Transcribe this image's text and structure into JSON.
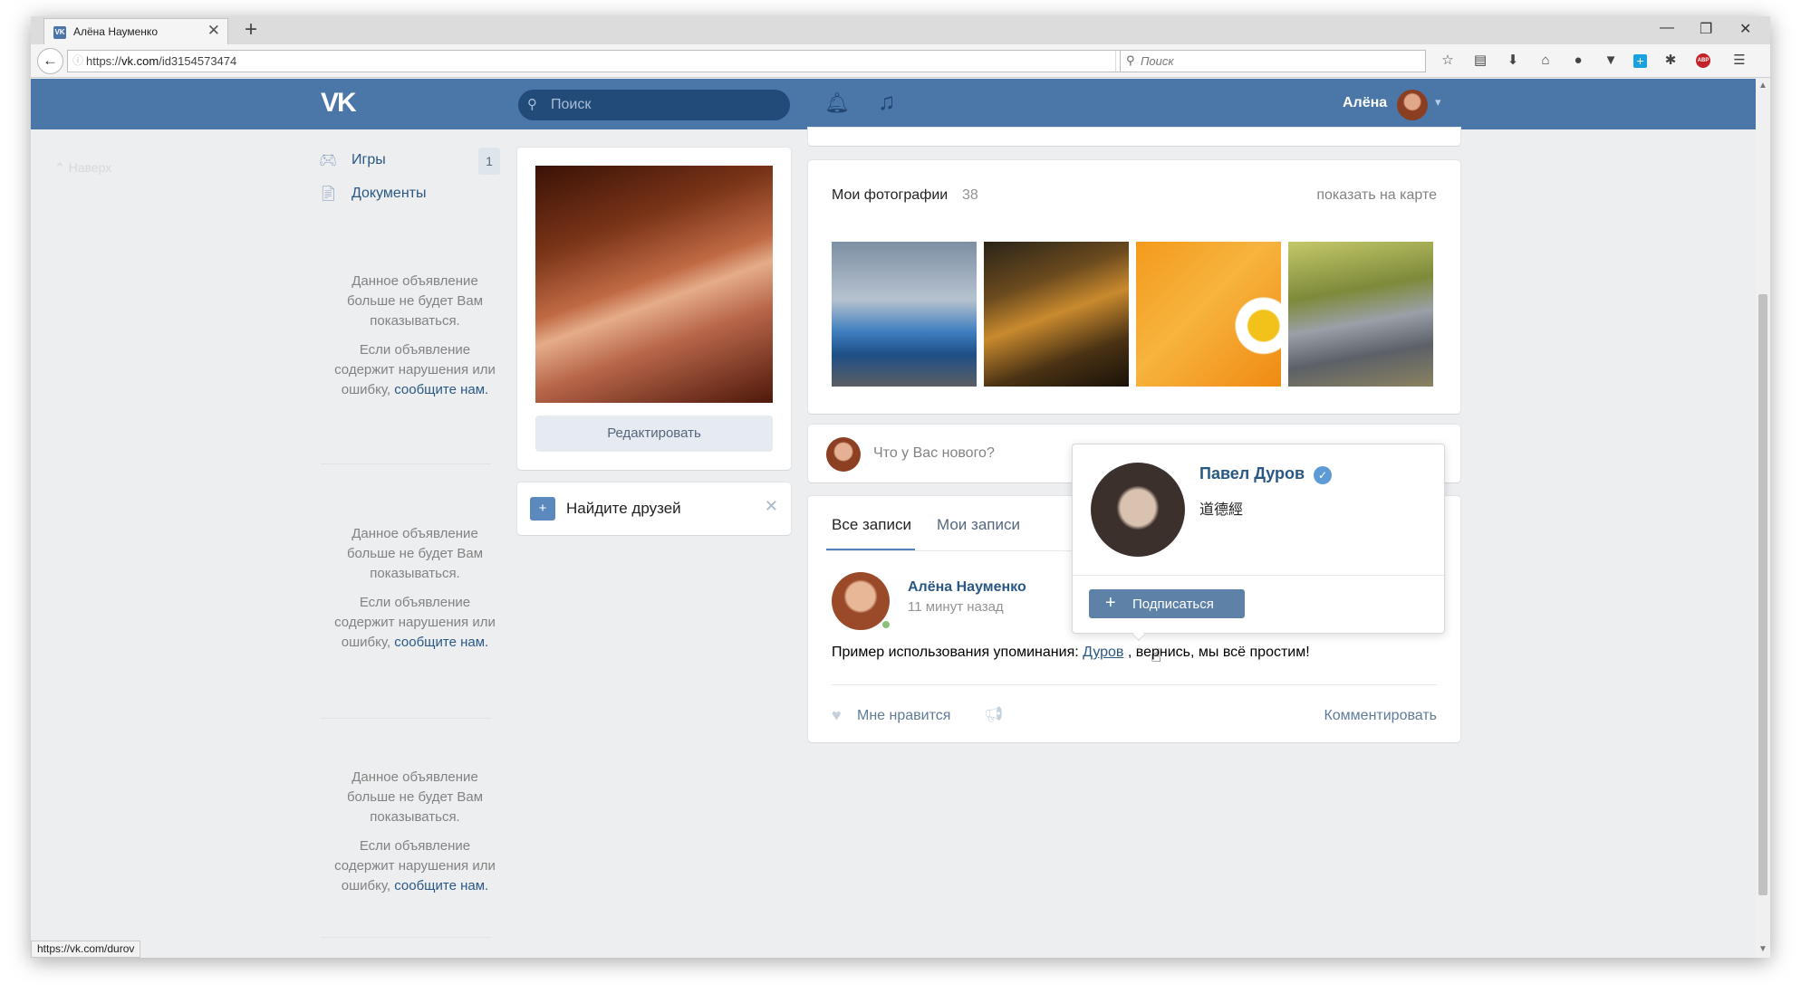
{
  "browser": {
    "tab_title": "Алёна Науменко",
    "favicon_text": "VK",
    "tab_close": "✕",
    "new_tab": "+",
    "window_controls": {
      "minimize": "—",
      "maximize": "❐",
      "close": "✕"
    },
    "url_prefix": "https://",
    "url_domain": "vk.com",
    "url_path": "/id3154573474",
    "search_placeholder": "Поиск",
    "status_url": "https://vk.com/durov",
    "toolbar_icons": [
      "star-icon",
      "reading-list-icon",
      "download-icon",
      "home-icon",
      "chat-icon",
      "pocket-icon",
      "plus-addon-icon",
      "settings-addon-icon",
      "adblock-icon",
      "menu-icon"
    ],
    "adblock_label": "ABP"
  },
  "vk_header": {
    "logo": "VK",
    "search_placeholder": "Поиск",
    "user_name": "Алёна",
    "color": "#4a76a8"
  },
  "sidebar": {
    "nav_label": "Наверх",
    "items": [
      {
        "label": "Игры",
        "icon": "gamepad-icon",
        "count": "1"
      },
      {
        "label": "Документы",
        "icon": "document-icon"
      }
    ],
    "ads": [
      {
        "hidden_text": "Данное объявление больше не будет Вам показываться.",
        "report_text": "Если объявление содержит нарушения или ошибку,",
        "report_link": "сообщите нам."
      },
      {
        "hidden_text": "Данное объявление больше не будет Вам показываться.",
        "report_text": "Если объявление содержит нарушения или ошибку,",
        "report_link": "сообщите нам."
      },
      {
        "hidden_text": "Данное объявление больше не будет Вам показываться.",
        "report_text": "Если объявление содержит нарушения или ошибку,",
        "report_link": "сообщите нам."
      }
    ]
  },
  "profile": {
    "edit_button": "Редактировать",
    "find_friends": "Найдите друзей"
  },
  "photos": {
    "title": "Мои фотографии",
    "count": "38",
    "map_link": "показать на карте"
  },
  "composer": {
    "placeholder": "Что у Вас нового?"
  },
  "feed": {
    "tabs": [
      "Все записи",
      "Мои записи"
    ],
    "active_tab_color": "#5181b8"
  },
  "post": {
    "author": "Алёна Науменко",
    "time": "11 минут назад",
    "text_before": "Пример использования упоминания: ",
    "mention": "Дуров",
    "text_after": " , вернись, мы всё простим!",
    "like_label": "Мне нравится",
    "comment_label": "Комментировать"
  },
  "mention_popup": {
    "name": "Павел Дуров",
    "verified": "✓",
    "status": "道德經",
    "subscribe_button": "Подписаться"
  }
}
